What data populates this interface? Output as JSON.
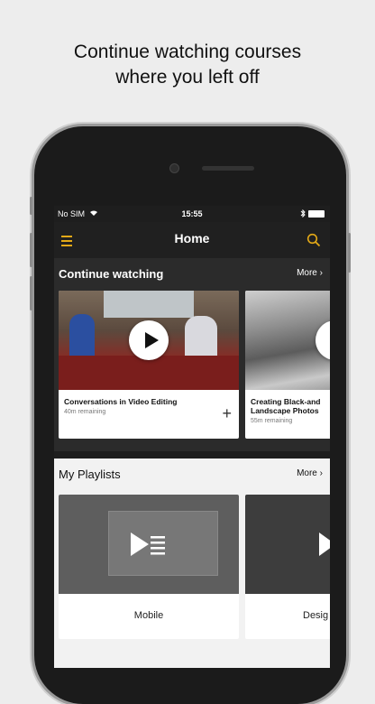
{
  "headline": {
    "line1": "Continue watching courses",
    "line2": "where you left off"
  },
  "status_bar": {
    "carrier": "No SIM",
    "time": "15:55"
  },
  "nav": {
    "title": "Home",
    "menu_icon": "hamburger-icon",
    "search_icon": "search-icon",
    "accent": "#e3a917"
  },
  "continue_watching": {
    "title": "Continue watching",
    "more": "More",
    "courses": [
      {
        "title": "Conversations in Video Editing",
        "remaining": "40m remaining"
      },
      {
        "title": "Creating Black-and Landscape Photos",
        "remaining": "55m remaining"
      }
    ]
  },
  "playlists": {
    "title": "My Playlists",
    "more": "More",
    "items": [
      {
        "name": "Mobile"
      },
      {
        "name": "Desig"
      }
    ]
  }
}
